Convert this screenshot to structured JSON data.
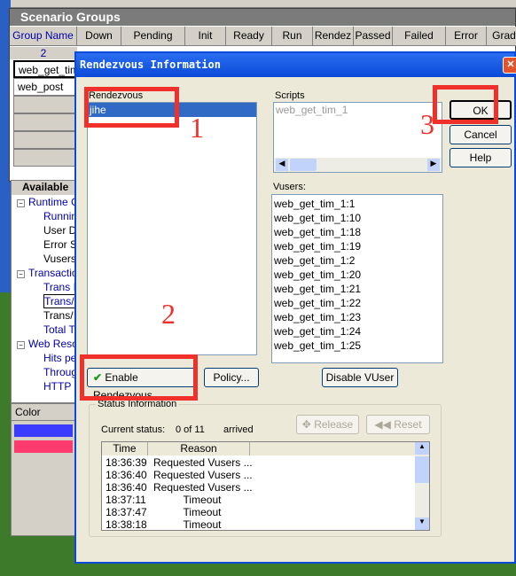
{
  "scenario_groups": {
    "title": "Scenario Groups",
    "columns": [
      "Group Name",
      "Down",
      "Pending",
      "Init",
      "Ready",
      "Run",
      "Rendez",
      "Passed",
      "Failed",
      "Error",
      "Grad"
    ],
    "count": "2",
    "groups": [
      "web_get_tim_",
      "web_post"
    ]
  },
  "available": {
    "title": "Available",
    "tree": [
      {
        "label": "Runtime G",
        "level": 0
      },
      {
        "label": "Runnin",
        "level": 1
      },
      {
        "label": "User D",
        "level": 1,
        "black": true
      },
      {
        "label": "Error S",
        "level": 1,
        "black": true
      },
      {
        "label": "Vusers",
        "level": 1,
        "black": true
      },
      {
        "label": "Transactio",
        "level": 0
      },
      {
        "label": "Trans I",
        "level": 1
      },
      {
        "label": "Trans/",
        "level": 1,
        "boxed": true
      },
      {
        "label": "Trans/",
        "level": 1,
        "black": true
      },
      {
        "label": "Total T",
        "level": 1
      },
      {
        "label": "Web Reso",
        "level": 0
      },
      {
        "label": "Hits pe",
        "level": 1
      },
      {
        "label": "Throug",
        "level": 1
      },
      {
        "label": "HTTP",
        "level": 1
      }
    ]
  },
  "color_panel": {
    "header": "Color",
    "colors": [
      "#3b3bff",
      "#ff3a6e"
    ]
  },
  "dialog": {
    "title": "Rendezvous Information",
    "rendezvous_label": "Rendezvous",
    "rendezvous": [
      "jihe"
    ],
    "scripts_label": "Scripts",
    "scripts": [
      "web_get_tim_1"
    ],
    "vusers_label": "Vusers:",
    "vusers": [
      "web_get_tim_1:1",
      "web_get_tim_1:10",
      "web_get_tim_1:18",
      "web_get_tim_1:19",
      "web_get_tim_1:2",
      "web_get_tim_1:20",
      "web_get_tim_1:21",
      "web_get_tim_1:22",
      "web_get_tim_1:23",
      "web_get_tim_1:24",
      "web_get_tim_1:25"
    ],
    "ok": "OK",
    "cancel": "Cancel",
    "help": "Help",
    "enable": "Enable Rendezvous",
    "policy": "Policy...",
    "disable_vuser": "Disable VUser",
    "status_group": "Status Information",
    "current_status_label": "Current status:",
    "current_status": "0 of 11",
    "arrived": "arrived",
    "release": "Release",
    "reset": "Reset",
    "table_cols": [
      "Time",
      "Reason"
    ],
    "rows": [
      [
        "18:36:39",
        "Requested Vusers ..."
      ],
      [
        "18:36:40",
        "Requested Vusers ..."
      ],
      [
        "18:36:40",
        "Requested Vusers ..."
      ],
      [
        "18:37:11",
        "Timeout"
      ],
      [
        "18:37:47",
        "Timeout"
      ],
      [
        "18:38:18",
        "Timeout"
      ]
    ]
  },
  "annotations": [
    "1",
    "2",
    "3"
  ],
  "accent": "#0a4ad8",
  "annotation_color": "#f0302a"
}
